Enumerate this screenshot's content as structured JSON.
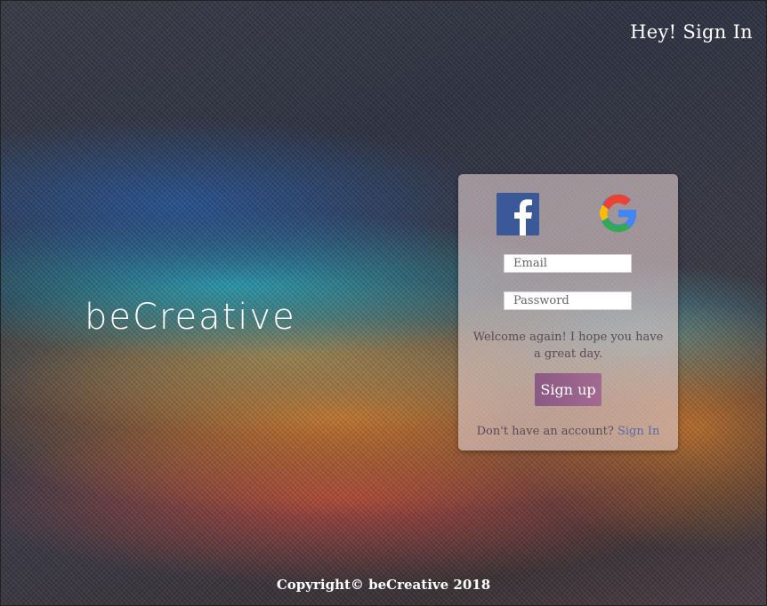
{
  "header": {
    "sign_in_link": "Hey! Sign In"
  },
  "brand": {
    "name": "beCreative"
  },
  "card": {
    "social": {
      "facebook_icon": "facebook-icon",
      "google_icon": "google-icon"
    },
    "email_placeholder": "Email",
    "password_placeholder": "Password",
    "welcome_text": "Welcome again! I hope you have a great day.",
    "signup_button": "Sign up",
    "no_account_text": "Don't have an account?",
    "sign_in_link": "Sign In"
  },
  "footer": {
    "copyright": "Copyright© beCreative 2018"
  },
  "colors": {
    "facebook": "#3b5998",
    "button": "#95628a",
    "link": "#5a6aa6"
  }
}
